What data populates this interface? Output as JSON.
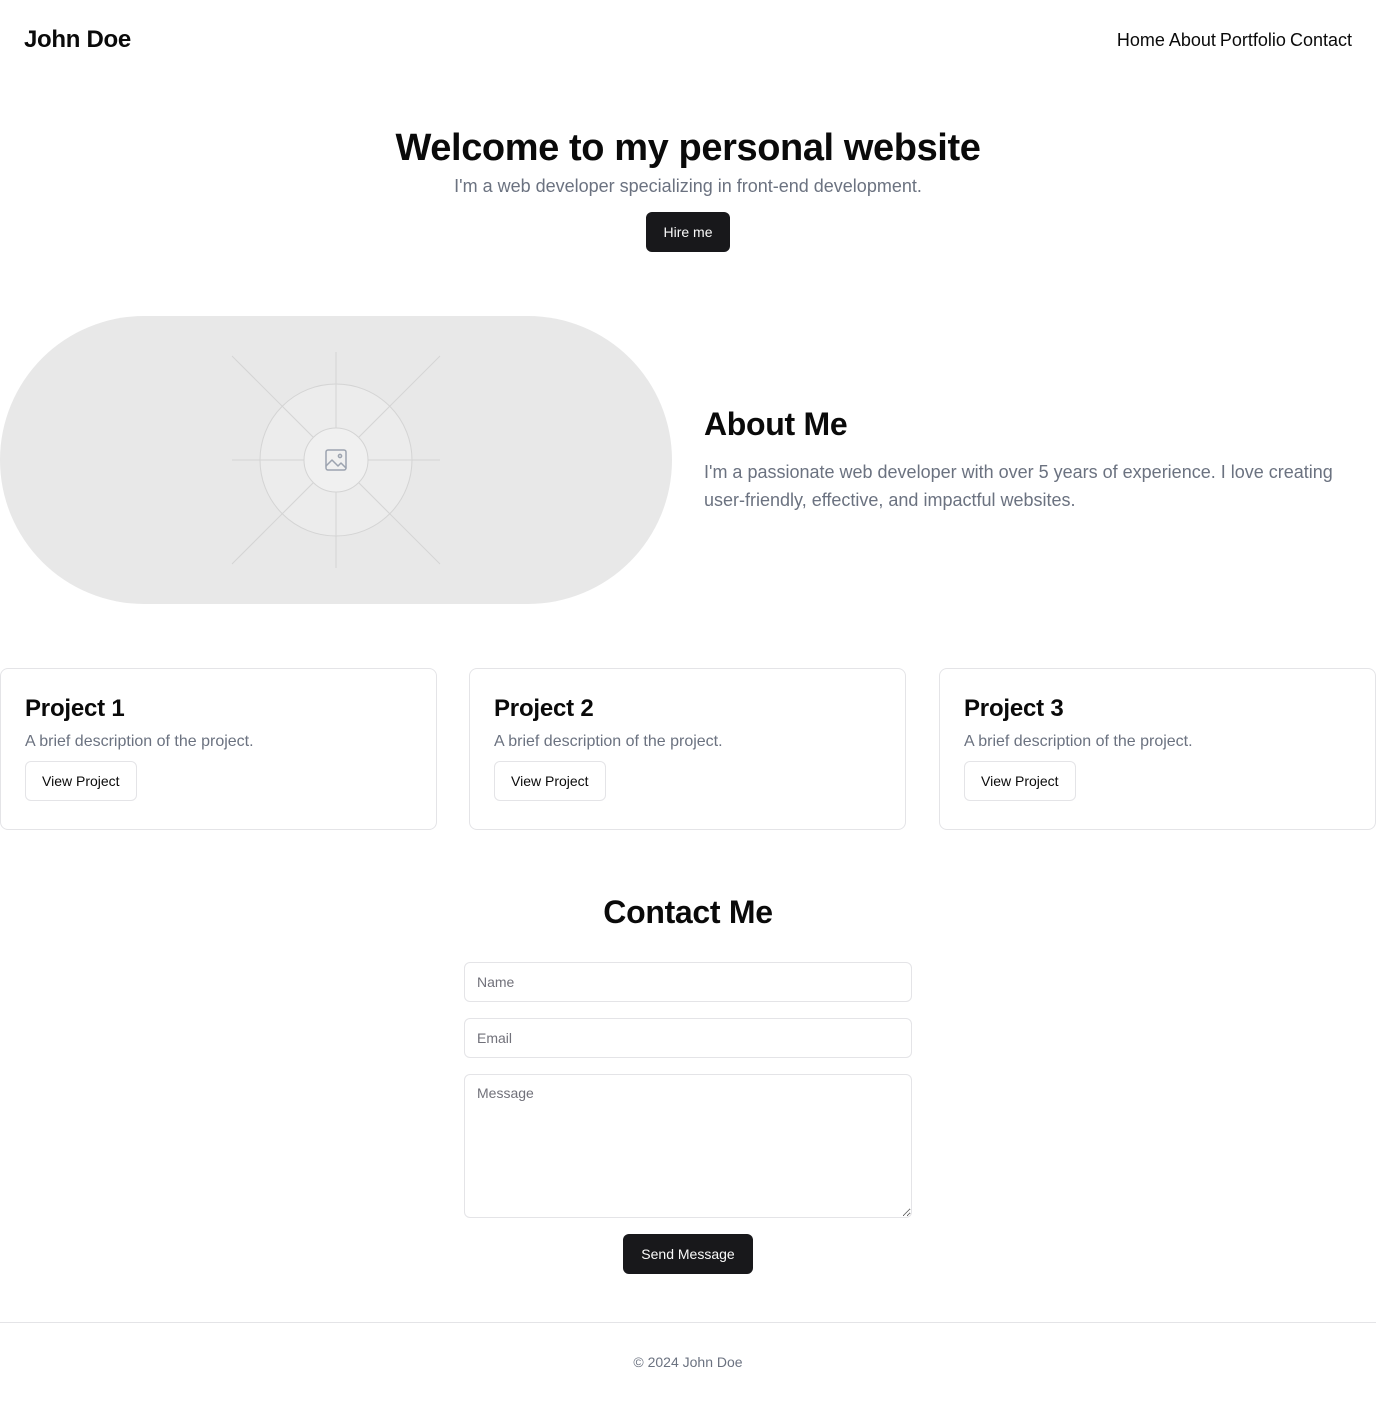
{
  "header": {
    "brand": "John Doe",
    "nav": [
      "Home",
      "About",
      "Portfolio",
      "Contact"
    ]
  },
  "hero": {
    "title": "Welcome to my personal website",
    "subtitle": "I'm a web developer specializing in front-end development.",
    "cta_label": "Hire me"
  },
  "about": {
    "image_icon": "image-placeholder-icon",
    "title": "About Me",
    "text": "I'm a passionate web developer with over 5 years of experience. I love creating user-friendly, effective, and impactful websites."
  },
  "projects": [
    {
      "title": "Project 1",
      "description": "A brief description of the project.",
      "button": "View Project"
    },
    {
      "title": "Project 2",
      "description": "A brief description of the project.",
      "button": "View Project"
    },
    {
      "title": "Project 3",
      "description": "A brief description of the project.",
      "button": "View Project"
    }
  ],
  "contact": {
    "title": "Contact Me",
    "name_placeholder": "Name",
    "email_placeholder": "Email",
    "message_placeholder": "Message",
    "send_label": "Send Message"
  },
  "footer": {
    "text": "© 2024 John Doe"
  },
  "colors": {
    "primary_button": "#18181b",
    "muted_text": "#6b7280",
    "border": "#e4e4e7",
    "placeholder_bg": "#e8e8e8"
  }
}
